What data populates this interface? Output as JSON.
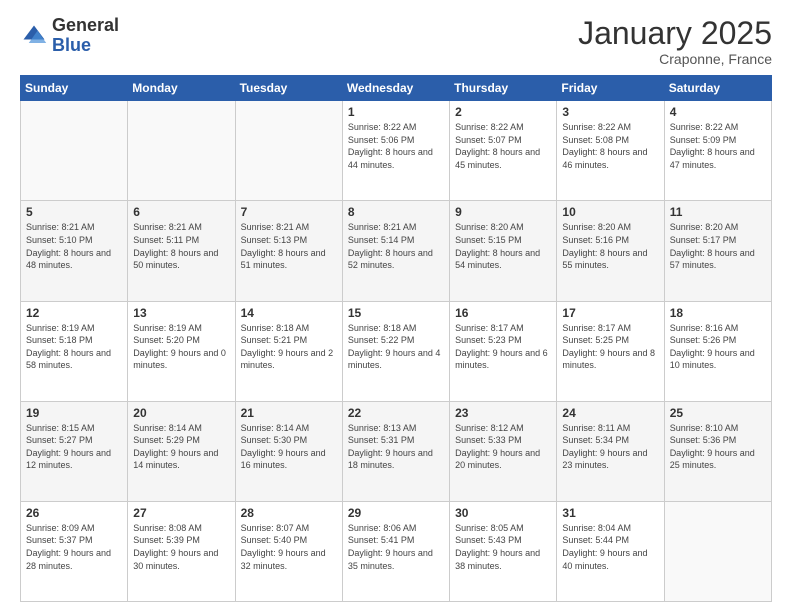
{
  "logo": {
    "general": "General",
    "blue": "Blue"
  },
  "title": "January 2025",
  "location": "Craponne, France",
  "days_header": [
    "Sunday",
    "Monday",
    "Tuesday",
    "Wednesday",
    "Thursday",
    "Friday",
    "Saturday"
  ],
  "weeks": [
    [
      {
        "day": "",
        "info": ""
      },
      {
        "day": "",
        "info": ""
      },
      {
        "day": "",
        "info": ""
      },
      {
        "day": "1",
        "info": "Sunrise: 8:22 AM\nSunset: 5:06 PM\nDaylight: 8 hours\nand 44 minutes."
      },
      {
        "day": "2",
        "info": "Sunrise: 8:22 AM\nSunset: 5:07 PM\nDaylight: 8 hours\nand 45 minutes."
      },
      {
        "day": "3",
        "info": "Sunrise: 8:22 AM\nSunset: 5:08 PM\nDaylight: 8 hours\nand 46 minutes."
      },
      {
        "day": "4",
        "info": "Sunrise: 8:22 AM\nSunset: 5:09 PM\nDaylight: 8 hours\nand 47 minutes."
      }
    ],
    [
      {
        "day": "5",
        "info": "Sunrise: 8:21 AM\nSunset: 5:10 PM\nDaylight: 8 hours\nand 48 minutes."
      },
      {
        "day": "6",
        "info": "Sunrise: 8:21 AM\nSunset: 5:11 PM\nDaylight: 8 hours\nand 50 minutes."
      },
      {
        "day": "7",
        "info": "Sunrise: 8:21 AM\nSunset: 5:13 PM\nDaylight: 8 hours\nand 51 minutes."
      },
      {
        "day": "8",
        "info": "Sunrise: 8:21 AM\nSunset: 5:14 PM\nDaylight: 8 hours\nand 52 minutes."
      },
      {
        "day": "9",
        "info": "Sunrise: 8:20 AM\nSunset: 5:15 PM\nDaylight: 8 hours\nand 54 minutes."
      },
      {
        "day": "10",
        "info": "Sunrise: 8:20 AM\nSunset: 5:16 PM\nDaylight: 8 hours\nand 55 minutes."
      },
      {
        "day": "11",
        "info": "Sunrise: 8:20 AM\nSunset: 5:17 PM\nDaylight: 8 hours\nand 57 minutes."
      }
    ],
    [
      {
        "day": "12",
        "info": "Sunrise: 8:19 AM\nSunset: 5:18 PM\nDaylight: 8 hours\nand 58 minutes."
      },
      {
        "day": "13",
        "info": "Sunrise: 8:19 AM\nSunset: 5:20 PM\nDaylight: 9 hours\nand 0 minutes."
      },
      {
        "day": "14",
        "info": "Sunrise: 8:18 AM\nSunset: 5:21 PM\nDaylight: 9 hours\nand 2 minutes."
      },
      {
        "day": "15",
        "info": "Sunrise: 8:18 AM\nSunset: 5:22 PM\nDaylight: 9 hours\nand 4 minutes."
      },
      {
        "day": "16",
        "info": "Sunrise: 8:17 AM\nSunset: 5:23 PM\nDaylight: 9 hours\nand 6 minutes."
      },
      {
        "day": "17",
        "info": "Sunrise: 8:17 AM\nSunset: 5:25 PM\nDaylight: 9 hours\nand 8 minutes."
      },
      {
        "day": "18",
        "info": "Sunrise: 8:16 AM\nSunset: 5:26 PM\nDaylight: 9 hours\nand 10 minutes."
      }
    ],
    [
      {
        "day": "19",
        "info": "Sunrise: 8:15 AM\nSunset: 5:27 PM\nDaylight: 9 hours\nand 12 minutes."
      },
      {
        "day": "20",
        "info": "Sunrise: 8:14 AM\nSunset: 5:29 PM\nDaylight: 9 hours\nand 14 minutes."
      },
      {
        "day": "21",
        "info": "Sunrise: 8:14 AM\nSunset: 5:30 PM\nDaylight: 9 hours\nand 16 minutes."
      },
      {
        "day": "22",
        "info": "Sunrise: 8:13 AM\nSunset: 5:31 PM\nDaylight: 9 hours\nand 18 minutes."
      },
      {
        "day": "23",
        "info": "Sunrise: 8:12 AM\nSunset: 5:33 PM\nDaylight: 9 hours\nand 20 minutes."
      },
      {
        "day": "24",
        "info": "Sunrise: 8:11 AM\nSunset: 5:34 PM\nDaylight: 9 hours\nand 23 minutes."
      },
      {
        "day": "25",
        "info": "Sunrise: 8:10 AM\nSunset: 5:36 PM\nDaylight: 9 hours\nand 25 minutes."
      }
    ],
    [
      {
        "day": "26",
        "info": "Sunrise: 8:09 AM\nSunset: 5:37 PM\nDaylight: 9 hours\nand 28 minutes."
      },
      {
        "day": "27",
        "info": "Sunrise: 8:08 AM\nSunset: 5:39 PM\nDaylight: 9 hours\nand 30 minutes."
      },
      {
        "day": "28",
        "info": "Sunrise: 8:07 AM\nSunset: 5:40 PM\nDaylight: 9 hours\nand 32 minutes."
      },
      {
        "day": "29",
        "info": "Sunrise: 8:06 AM\nSunset: 5:41 PM\nDaylight: 9 hours\nand 35 minutes."
      },
      {
        "day": "30",
        "info": "Sunrise: 8:05 AM\nSunset: 5:43 PM\nDaylight: 9 hours\nand 38 minutes."
      },
      {
        "day": "31",
        "info": "Sunrise: 8:04 AM\nSunset: 5:44 PM\nDaylight: 9 hours\nand 40 minutes."
      },
      {
        "day": "",
        "info": ""
      }
    ]
  ]
}
